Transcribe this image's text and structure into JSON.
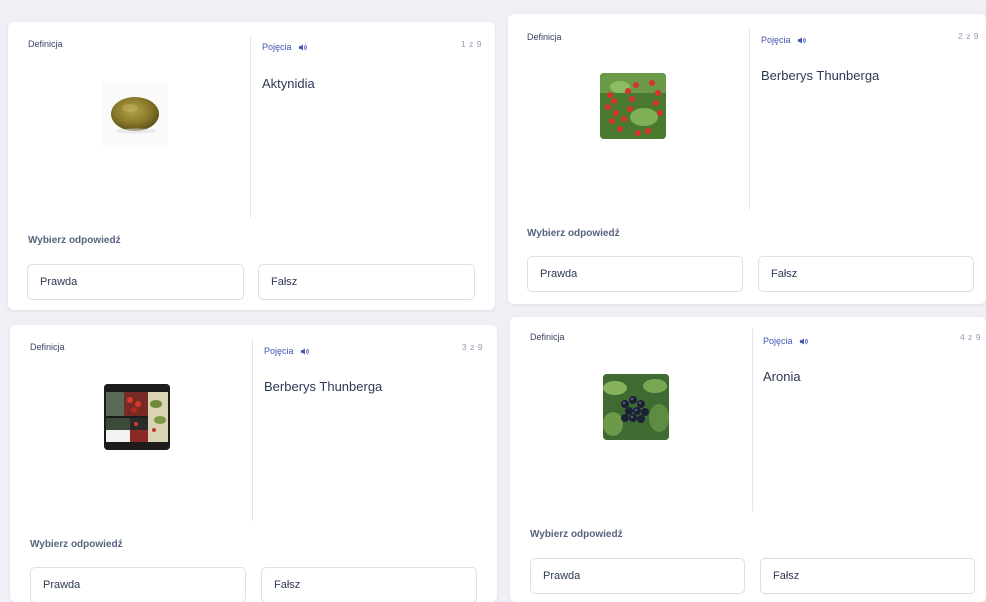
{
  "cards": [
    {
      "definition_label": "Definicja",
      "term_label": "Pojęcia",
      "counter": "1 z 9",
      "term": "Aktynidia",
      "image": "kiwi-fruit",
      "prompt": "Wybierz odpowiedź",
      "true_label": "Prawda",
      "false_label": "Fałsz"
    },
    {
      "definition_label": "Definicja",
      "term_label": "Pojęcia",
      "counter": "2 z 9",
      "term": "Berberys Thunberga",
      "image": "red-berries-branch",
      "prompt": "Wybierz odpowiedź",
      "true_label": "Prawda",
      "false_label": "Fałsz"
    },
    {
      "definition_label": "Definicja",
      "term_label": "Pojęcia",
      "counter": "3 z 9",
      "term": "Berberys Thunberga",
      "image": "berberis-collage",
      "prompt": "Wybierz odpowiedź",
      "true_label": "Prawda",
      "false_label": "Fałsz"
    },
    {
      "definition_label": "Definicja",
      "term_label": "Pojęcia",
      "counter": "4 z 9",
      "term": "Aronia",
      "image": "black-chokeberries",
      "prompt": "Wybierz odpowiedź",
      "true_label": "Prawda",
      "false_label": "Fałsz"
    }
  ],
  "icons": {
    "audio": "speaker-icon"
  },
  "colors": {
    "accent": "#4257b2",
    "background": "#eef0f6",
    "card": "#ffffff",
    "text": "#2e3856"
  }
}
